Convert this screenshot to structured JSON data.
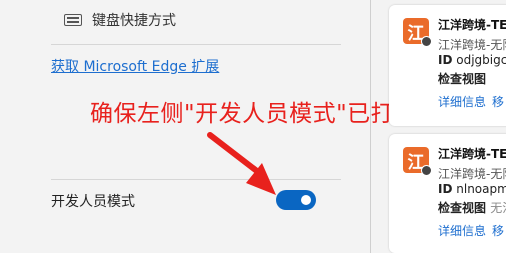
{
  "settings": {
    "keyboard_shortcuts": "键盘快捷方式",
    "get_extensions_link": "获取 Microsoft Edge 扩展",
    "developer_mode_label": "开发人员模式",
    "developer_mode_on": true
  },
  "annotation": {
    "text": "确保左侧\"开发人员模式\"已打开",
    "color": "#e8211d"
  },
  "extensions": [
    {
      "icon_letter": "江",
      "title": "江洋跨境-TE",
      "subtitle": "江洋跨境-无限",
      "id_label": "ID",
      "id_value": "odjgbigc",
      "inspect_label": "检查视图",
      "inspect_extra": "",
      "details_link": "详细信息",
      "remove_link": "移"
    },
    {
      "icon_letter": "江",
      "title": "江洋跨境-TE",
      "subtitle": "江洋跨境-无限",
      "id_label": "ID",
      "id_value": "nlnoapm",
      "inspect_label": "检查视图",
      "inspect_extra": "无法",
      "details_link": "详细信息",
      "remove_link": "移"
    }
  ],
  "colors": {
    "accent": "#0a66c2",
    "link": "#1d6ecf",
    "extension_icon": "#ea6b2a"
  }
}
